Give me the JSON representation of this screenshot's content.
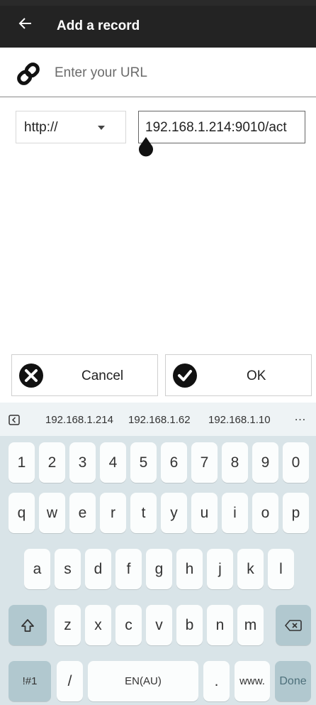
{
  "app_bar": {
    "title": "Add a record",
    "back_icon": "arrow-left-icon"
  },
  "url_row": {
    "icon": "link-icon",
    "placeholder": "Enter your URL"
  },
  "protocol_select": {
    "selected": "http://"
  },
  "host_input": {
    "value": "192.168.1.214:9010/act"
  },
  "buttons": {
    "cancel": "Cancel",
    "ok": "OK"
  },
  "keyboard": {
    "suggestions": [
      "192.168.1.214",
      "192.168.1.62",
      "192.168.1.10"
    ],
    "more": "…",
    "number_row": [
      "1",
      "2",
      "3",
      "4",
      "5",
      "6",
      "7",
      "8",
      "9",
      "0"
    ],
    "row1": [
      "q",
      "w",
      "e",
      "r",
      "t",
      "y",
      "u",
      "i",
      "o",
      "p"
    ],
    "row2": [
      "a",
      "s",
      "d",
      "f",
      "g",
      "h",
      "j",
      "k",
      "l"
    ],
    "row3": [
      "z",
      "x",
      "c",
      "v",
      "b",
      "n",
      "m"
    ],
    "symbols": "!#1",
    "slash": "/",
    "space": "EN(AU)",
    "period": ".",
    "www": "www.",
    "done": "Done"
  },
  "colors": {
    "app_bar": "#232323",
    "keyboard_bg": "#d9e4e8",
    "key_bg": "#fbfdfd",
    "key_dark": "#b1c8cf"
  }
}
